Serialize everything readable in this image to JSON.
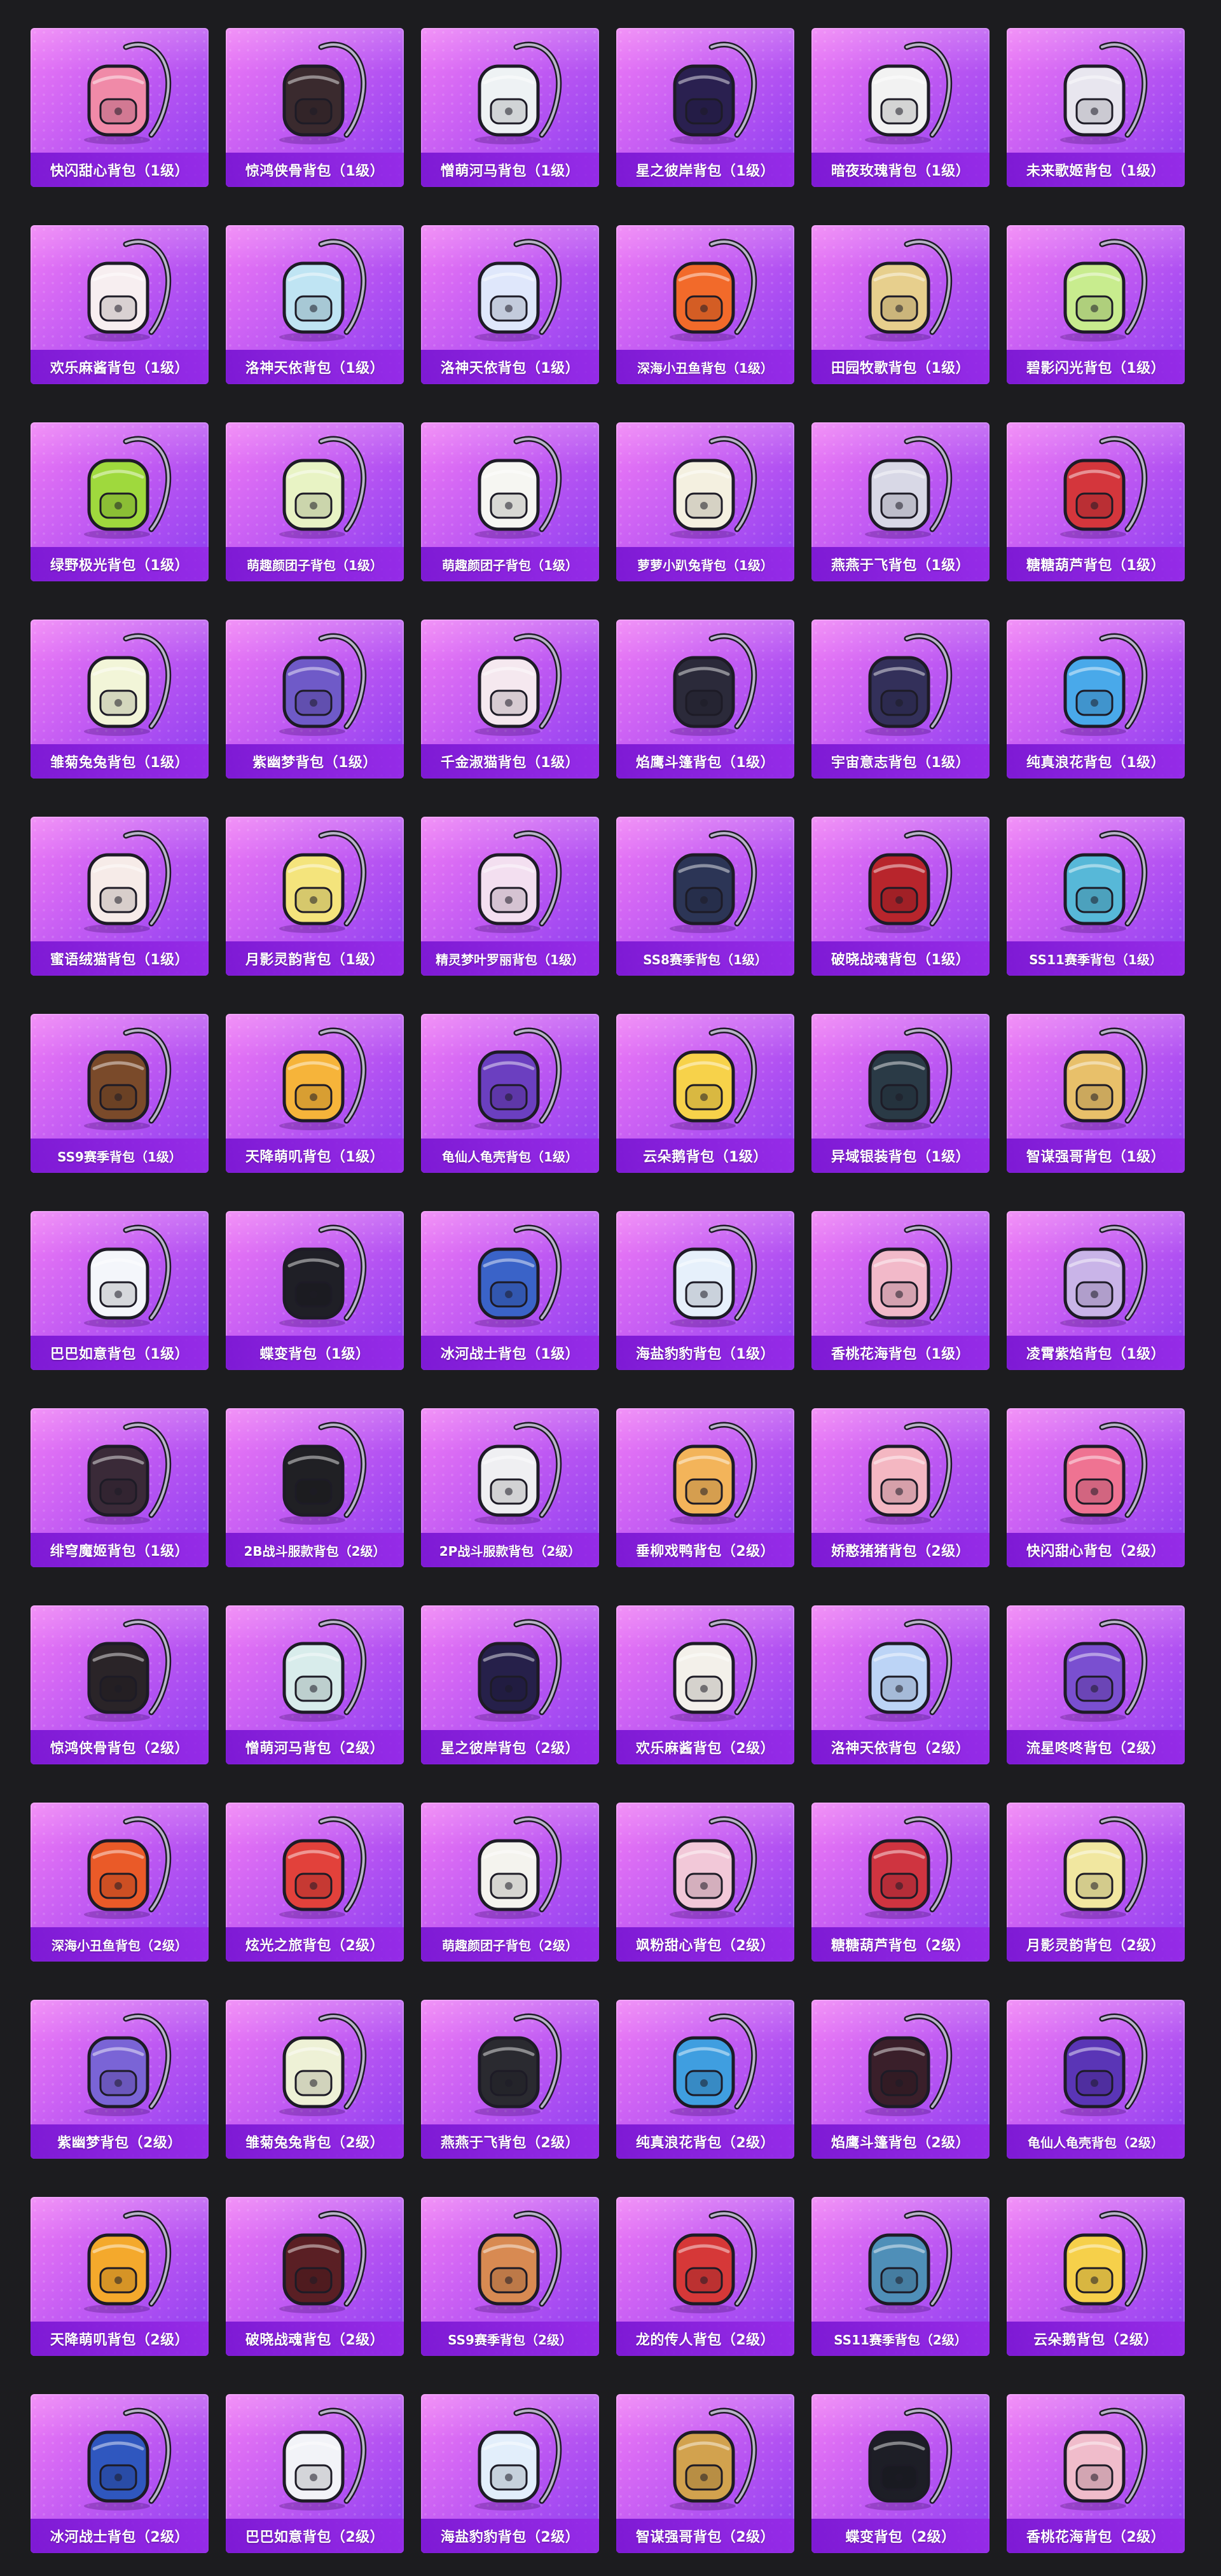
{
  "theme": {
    "page_background": "#1c1c1f",
    "card_gradient": [
      "#f07cf6",
      "#c45cf3",
      "#8a3cf0"
    ],
    "label_bar": "#7814d2",
    "label_text": "#ffffff"
  },
  "items": [
    {
      "name": "快闪甜心背包（1级）",
      "icon": "pink-camera-backpack-icon",
      "color": "#f08aa8"
    },
    {
      "name": "惊鸿侠骨背包（1级）",
      "icon": "black-red-backpack-icon",
      "color": "#3a2a2e"
    },
    {
      "name": "憎萌河马背包（1级）",
      "icon": "white-hippo-backpack-icon",
      "color": "#eef2f4"
    },
    {
      "name": "星之彼岸背包（1级）",
      "icon": "astronaut-helmet-backpack-icon",
      "color": "#2a2050"
    },
    {
      "name": "暗夜玫瑰背包（1级）",
      "icon": "rose-pet-backpack-icon",
      "color": "#f2f2f2"
    },
    {
      "name": "未来歌姬背包（1级）",
      "icon": "white-idol-backpack-icon",
      "color": "#e8e6ef"
    },
    {
      "name": "欢乐麻酱背包（1级）",
      "icon": "panda-backpack-icon",
      "color": "#f7eef0"
    },
    {
      "name": "洛神天依背包（1级）",
      "icon": "blue-helmet-backpack-icon",
      "color": "#bfe4f3"
    },
    {
      "name": "洛神天依背包（1级）",
      "icon": "crystal-backpack-icon",
      "color": "#dfe7fb"
    },
    {
      "name": "深海小丑鱼背包（1级）",
      "icon": "clownfish-backpack-icon",
      "color": "#f26a2a"
    },
    {
      "name": "田园牧歌背包（1级）",
      "icon": "basket-backpack-icon",
      "color": "#e7cf8d"
    },
    {
      "name": "碧影闪光背包（1级）",
      "icon": "green-cat-backpack-icon",
      "color": "#c8ec8e"
    },
    {
      "name": "绿野极光背包（1级）",
      "icon": "green-black-backpack-icon",
      "color": "#9fd93d"
    },
    {
      "name": "萌趣颜团子背包（1级）",
      "icon": "green-helmet-backpack-icon",
      "color": "#e8f3c4"
    },
    {
      "name": "萌趣颜团子背包（1级）",
      "icon": "bunny-plush-backpack-icon",
      "color": "#f6f6f2"
    },
    {
      "name": "萝萝小趴兔背包（1级）",
      "icon": "lying-bunny-backpack-icon",
      "color": "#f4f0e0"
    },
    {
      "name": "燕燕于飞背包（1级）",
      "icon": "swallow-backpack-icon",
      "color": "#d8d8e6"
    },
    {
      "name": "糖糖葫芦背包（1级）",
      "icon": "candy-gourd-backpack-icon",
      "color": "#d4363c"
    },
    {
      "name": "雏菊兔兔背包（1级）",
      "icon": "daisy-bunny-backpack-icon",
      "color": "#f2f5d8"
    },
    {
      "name": "紫幽梦背包（1级）",
      "icon": "purple-dream-backpack-icon",
      "color": "#6f5ac8"
    },
    {
      "name": "千金淑猫背包（1级）",
      "icon": "cat-lady-backpack-icon",
      "color": "#f5e8ef"
    },
    {
      "name": "焰鹰斗篷背包（1级）",
      "icon": "flame-hawk-backpack-icon",
      "color": "#2b2a3a"
    },
    {
      "name": "宇宙意志背包（1级）",
      "icon": "cosmic-emblem-backpack-icon",
      "color": "#33305a"
    },
    {
      "name": "纯真浪花背包（1级）",
      "icon": "bubble-tea-backpack-icon",
      "color": "#49a9ea"
    },
    {
      "name": "蜜语绒猫背包（1级）",
      "icon": "plush-cat-backpack-icon",
      "color": "#f6ebe8"
    },
    {
      "name": "月影灵韵背包（1级）",
      "icon": "moon-charm-backpack-icon",
      "color": "#f4e47c"
    },
    {
      "name": "精灵梦叶罗丽背包（1级）",
      "icon": "heart-charm-backpack-icon",
      "color": "#f3dff0"
    },
    {
      "name": "SS8赛季背包（1级）",
      "icon": "ss8-backpack-icon",
      "color": "#2c3556"
    },
    {
      "name": "破晓战魂背包（1级）",
      "icon": "dawn-warrior-backpack-icon",
      "color": "#b8252c"
    },
    {
      "name": "SS11赛季背包（1级）",
      "icon": "ss11-backpack-icon",
      "color": "#57b8d8"
    },
    {
      "name": "SS9赛季背包（1级）",
      "icon": "ss9-backpack-icon",
      "color": "#7a4a2a"
    },
    {
      "name": "天降萌叽背包（1级）",
      "icon": "yellow-chick-backpack-icon",
      "color": "#f6b43a"
    },
    {
      "name": "龟仙人龟壳背包（1级）",
      "icon": "turtle-shell-backpack-icon",
      "color": "#6b3fc0"
    },
    {
      "name": "云朵鹅背包（1级）",
      "icon": "cloud-goose-backpack-icon",
      "color": "#f7d24a"
    },
    {
      "name": "异域银装背包（1级）",
      "icon": "silver-gear-backpack-icon",
      "color": "#2a3a46"
    },
    {
      "name": "智谋强哥背包（1级）",
      "icon": "bear-face-backpack-icon",
      "color": "#e8c06a"
    },
    {
      "name": "巴巴如意背包（1级）",
      "icon": "white-ghost-backpack-icon",
      "color": "#f4f6fb"
    },
    {
      "name": "蝶变背包（1级）",
      "icon": "butterfly-backpack-icon",
      "color": "#1f1f26"
    },
    {
      "name": "冰河战士背包（1级）",
      "icon": "ice-warrior-backpack-icon",
      "color": "#3a63c8"
    },
    {
      "name": "海盐豹豹背包（1级）",
      "icon": "sea-salt-seal-backpack-icon",
      "color": "#e6f0fb"
    },
    {
      "name": "香桃花海背包（1级）",
      "icon": "peach-blossom-backpack-icon",
      "color": "#f2b9c9"
    },
    {
      "name": "凌霄紫焰背包（1级）",
      "icon": "purple-flame-backpack-icon",
      "color": "#c9b4e8"
    },
    {
      "name": "绯穹魔姬背包（1级）",
      "icon": "demon-princess-backpack-icon",
      "color": "#3a2a38"
    },
    {
      "name": "2B战斗服款背包（2级）",
      "icon": "combat-suit-backpack-icon",
      "color": "#202024"
    },
    {
      "name": "2P战斗服款背包（2级）",
      "icon": "white-combat-backpack-icon",
      "color": "#efeff2"
    },
    {
      "name": "垂柳戏鸭背包（2级）",
      "icon": "duck-backpack-icon",
      "color": "#f3b45a"
    },
    {
      "name": "娇憨猪猪背包（2级）",
      "icon": "pig-backpack-icon",
      "color": "#f4b7c2"
    },
    {
      "name": "快闪甜心背包（2级）",
      "icon": "pink-round-backpack-icon",
      "color": "#ef7392"
    },
    {
      "name": "惊鸿侠骨背包（2级）",
      "icon": "black-red-lv2-backpack-icon",
      "color": "#2a2428"
    },
    {
      "name": "憎萌河马背包（2级）",
      "icon": "hippo-lv2-backpack-icon",
      "color": "#d8eceb"
    },
    {
      "name": "星之彼岸背包（2级）",
      "icon": "astronaut-lv2-backpack-icon",
      "color": "#26204a"
    },
    {
      "name": "欢乐麻酱背包（2级）",
      "icon": "robot-panda-backpack-icon",
      "color": "#f3f0ea"
    },
    {
      "name": "洛神天依背包（2级）",
      "icon": "crystal-lv2-backpack-icon",
      "color": "#bcd4f6"
    },
    {
      "name": "流星咚咚背包（2级）",
      "icon": "meteor-drum-backpack-icon",
      "color": "#7a4fd0"
    },
    {
      "name": "深海小丑鱼背包（2级）",
      "icon": "clownfish-lv2-backpack-icon",
      "color": "#ea5a28"
    },
    {
      "name": "炫光之旅背包（2级）",
      "icon": "arcade-backpack-icon",
      "color": "#e2413b"
    },
    {
      "name": "萌趣颜团子背包（2级）",
      "icon": "bunny-lv2-backpack-icon",
      "color": "#f4f3ee"
    },
    {
      "name": "飒粉甜心背包（2级）",
      "icon": "pink-sweet-backpack-icon",
      "color": "#f2c8d8"
    },
    {
      "name": "糖糖葫芦背包（2级）",
      "icon": "candy-gourd-lv2-backpack-icon",
      "color": "#cf3440"
    },
    {
      "name": "月影灵韵背包（2级）",
      "icon": "moon-lv2-backpack-icon",
      "color": "#f1e7a0"
    },
    {
      "name": "紫幽梦背包（2级）",
      "icon": "purple-dream-lv2-backpack-icon",
      "color": "#7a64d6"
    },
    {
      "name": "雏菊兔兔背包（2级）",
      "icon": "daisy-lv2-backpack-icon",
      "color": "#eef1d6"
    },
    {
      "name": "燕燕于飞背包（2级）",
      "icon": "swallow-lv2-backpack-icon",
      "color": "#2a2a30"
    },
    {
      "name": "纯真浪花背包（2级）",
      "icon": "bubble-tea-lv2-backpack-icon",
      "color": "#3f9ee0"
    },
    {
      "name": "焰鹰斗篷背包（2级）",
      "icon": "flame-hawk-lv2-backpack-icon",
      "color": "#3a1f2a"
    },
    {
      "name": "龟仙人龟壳背包（2级）",
      "icon": "turtle-lv2-backpack-icon",
      "color": "#5a35b6"
    },
    {
      "name": "天降萌叽背包（2级）",
      "icon": "yellow-chick-lv2-backpack-icon",
      "color": "#f4a92c"
    },
    {
      "name": "破晓战魂背包（2级）",
      "icon": "dawn-lv2-backpack-icon",
      "color": "#5a1f24"
    },
    {
      "name": "SS9赛季背包（2级）",
      "icon": "ss9-lv2-backpack-icon",
      "color": "#d88a52"
    },
    {
      "name": "龙的传人背包（2级）",
      "icon": "dragon-backpack-icon",
      "color": "#d63838"
    },
    {
      "name": "SS11赛季背包（2级）",
      "icon": "ss11-lv2-backpack-icon",
      "color": "#4f8fb8"
    },
    {
      "name": "云朵鹅背包（2级）",
      "icon": "cloud-goose-lv2-backpack-icon",
      "color": "#f6d04a"
    },
    {
      "name": "冰河战士背包（2级）",
      "icon": "ice-warrior-lv2-backpack-icon",
      "color": "#2f57bf"
    },
    {
      "name": "巴巴如意背包（2级）",
      "icon": "ghost-lv2-backpack-icon",
      "color": "#f2f3f8"
    },
    {
      "name": "海盐豹豹背包（2级）",
      "icon": "seal-lv2-backpack-icon",
      "color": "#e2eefb"
    },
    {
      "name": "智谋强哥背包（2级）",
      "icon": "bear-lv2-backpack-icon",
      "color": "#d2a24e"
    },
    {
      "name": "蝶变背包（2级）",
      "icon": "butterfly-lv2-backpack-icon",
      "color": "#1d1e26"
    },
    {
      "name": "香桃花海背包（2级）",
      "icon": "peach-lv2-backpack-icon",
      "color": "#f0bccb"
    }
  ]
}
